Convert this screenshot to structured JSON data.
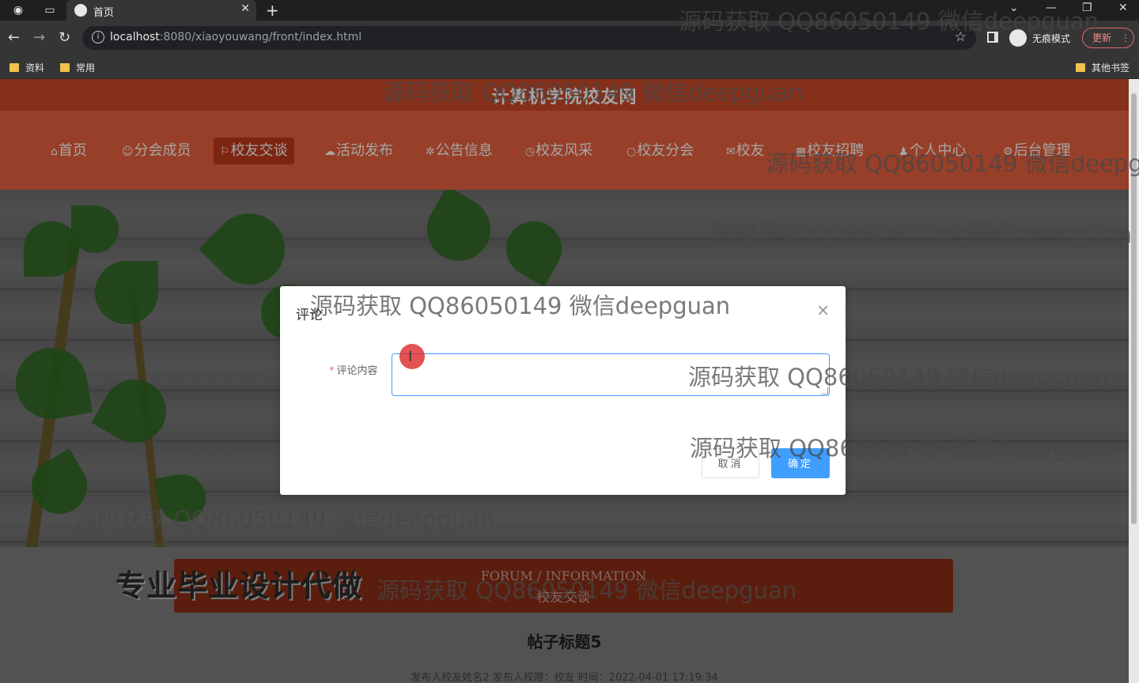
{
  "browser": {
    "tab_title": "首页",
    "url_host": "localhost",
    "url_path": ":8080/xiaoyouwang/front/index.html",
    "incognito_label": "无痕模式",
    "update_label": "更新",
    "bookmarks": [
      "资料",
      "常用"
    ],
    "other_bookmarks": "其他书签"
  },
  "site": {
    "title": "计算机学院校友网",
    "nav": [
      {
        "glyph": "⌂",
        "label": "首页"
      },
      {
        "glyph": "☺",
        "label": "分会成员"
      },
      {
        "glyph": "⚐",
        "label": "校友交谈"
      },
      {
        "glyph": "☁",
        "label": "活动发布"
      },
      {
        "glyph": "✲",
        "label": "公告信息"
      },
      {
        "glyph": "◷",
        "label": "校友风采"
      },
      {
        "glyph": "○",
        "label": "校友分会"
      },
      {
        "glyph": "✉",
        "label": "校友"
      },
      {
        "glyph": "▦",
        "label": "校友招聘"
      },
      {
        "glyph": "♟",
        "label": "个人中心"
      },
      {
        "glyph": "⚙",
        "label": "后台管理"
      }
    ],
    "active_nav": "校友交谈"
  },
  "section": {
    "en": "FORUM / INFORMATION",
    "cn": "校友交谈"
  },
  "promo_text": "专业毕业设计代做",
  "post": {
    "title": "帖子标题5",
    "meta": "发布人校友姓名2   发布人权限：校友   时间：2022-04-01 17:19:34"
  },
  "modal": {
    "title": "评论",
    "field_label": "评论内容",
    "required_mark": "*",
    "comment_value": "",
    "cancel_label": "取消",
    "confirm_label": "确定"
  },
  "watermark": "源码获取 QQ86050149 微信deepguan",
  "colors": {
    "header": "#cc4a2a",
    "nav": "#e8623e",
    "nav_active": "#c2391c",
    "primary_button": "#409eff"
  }
}
